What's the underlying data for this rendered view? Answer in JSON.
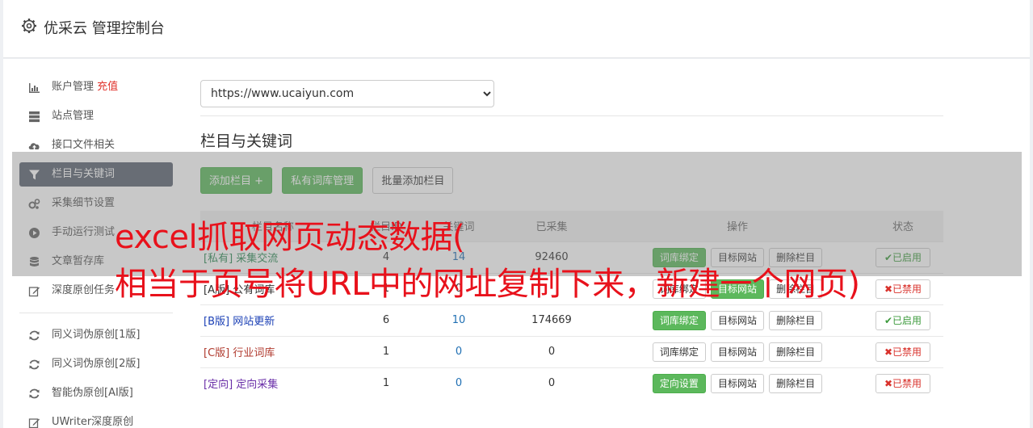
{
  "header": {
    "title": "优采云 管理控制台",
    "icon": "gear-icon"
  },
  "sidebar": {
    "items": [
      {
        "label": "账户管理",
        "extra": "充值",
        "icon": "bar-chart-icon"
      },
      {
        "label": "站点管理",
        "icon": "server-icon"
      },
      {
        "label": "接口文件相关",
        "icon": "cloud-upload-icon"
      },
      {
        "label": "栏目与关键词",
        "icon": "filter-icon",
        "active": true
      },
      {
        "label": "采集细节设置",
        "icon": "cogs-icon"
      },
      {
        "label": "手动运行测试",
        "icon": "play-circle-icon"
      },
      {
        "label": "文章暂存库",
        "icon": "database-icon"
      },
      {
        "label": "深度原创任务",
        "icon": "edit-icon"
      }
    ],
    "items2": [
      {
        "label": "同义词伪原创[1版]",
        "icon": "refresh-icon"
      },
      {
        "label": "同义词伪原创[2版]",
        "icon": "refresh-icon"
      },
      {
        "label": "智能伪原创[AI版]",
        "icon": "refresh-icon"
      },
      {
        "label": "UWriter深度原创",
        "icon": "edit-icon"
      }
    ]
  },
  "main": {
    "site_select": "https://www.ucaiyun.com",
    "section_title": "栏目与关键词",
    "buttons": {
      "add": "添加栏目 +",
      "private_lib": "私有词库管理",
      "batch_add": "批量添加栏目"
    },
    "table": {
      "headers": [
        "栏目名称",
        "栏目ID",
        "关键词",
        "已采集",
        "操作",
        "状态"
      ],
      "rows": [
        {
          "tag": "[私有]",
          "name": "采集交流",
          "id": "4",
          "kw": "14",
          "done": "92460",
          "op1": "词库绑定",
          "op2": "目标网站",
          "op3": "删除栏目",
          "state": "已启用"
        },
        {
          "tag": "[A版]",
          "name": "公有词库",
          "id": "1",
          "kw": "0",
          "done": "",
          "op1": "词库绑定",
          "op2": "目标网站",
          "op3": "删除栏目",
          "state": "已禁用"
        },
        {
          "tag": "[B版]",
          "name": "网站更新",
          "id": "6",
          "kw": "10",
          "done": "174669",
          "op1": "词库绑定",
          "op2": "目标网站",
          "op3": "删除栏目",
          "state": "已启用"
        },
        {
          "tag": "[C版]",
          "name": "行业词库",
          "id": "1",
          "kw": "0",
          "done": "0",
          "op1": "词库绑定",
          "op2": "目标网站",
          "op3": "删除栏目",
          "state": "已禁用"
        },
        {
          "tag": "[定向]",
          "name": "定向采集",
          "id": "1",
          "kw": "0",
          "done": "0",
          "op1": "定向设置",
          "op2": "目标网站",
          "op3": "删除栏目",
          "state": "已禁用"
        }
      ]
    }
  },
  "overlay": {
    "line1": "excel抓取网页动态数据(",
    "line2": "相当于页号将URL中的网址复制下来，新建一个网页)"
  },
  "colors": {
    "accent_green": "#5cb85c",
    "active_nav": "#5a6270",
    "overlay_text": "#e8111b"
  }
}
